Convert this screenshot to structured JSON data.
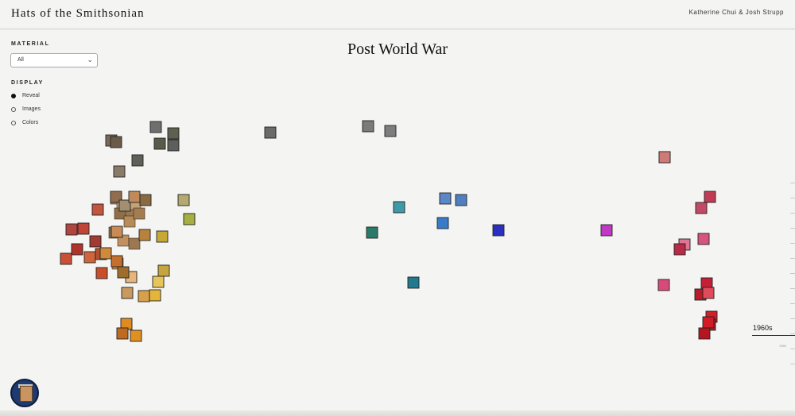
{
  "header": {
    "title": "Hats of the Smithsonian",
    "authors": "Katherine Chui & Josh Strupp"
  },
  "sidebar": {
    "material_label": "MATERIAL",
    "material_value": "All",
    "display_label": "DISPLAY",
    "display_options": [
      {
        "label": "Reveal",
        "selected": true
      },
      {
        "label": "Images",
        "selected": false
      },
      {
        "label": "Colors",
        "selected": false
      }
    ]
  },
  "main": {
    "title": "Post World War"
  },
  "timeline": {
    "decade": "1960s",
    "sub": "1960"
  },
  "swatches": [
    {
      "color": "#6f6f6f"
    },
    {
      "color": "#5e6050"
    },
    {
      "color": "#5a5a4a"
    },
    {
      "color": "#7b6a58"
    },
    {
      "color": "#6b5a48"
    },
    {
      "color": "#8a7a68"
    },
    {
      "color": "#5f5f58"
    },
    {
      "color": "#5d5f5c"
    },
    {
      "color": "#6a6a6a"
    },
    {
      "color": "#7a7a7a"
    },
    {
      "color": "#7d7d7d"
    },
    {
      "color": "#c98a87"
    },
    {
      "color": "#906d4f"
    },
    {
      "color": "#a38e70"
    },
    {
      "color": "#c08a5a"
    },
    {
      "color": "#8a6a40"
    },
    {
      "color": "#b5a870"
    },
    {
      "color": "#a5b040"
    },
    {
      "color": "#b0463f"
    },
    {
      "color": "#c04537"
    },
    {
      "color": "#a33a32"
    },
    {
      "color": "#c4543e"
    },
    {
      "color": "#b03329"
    },
    {
      "color": "#d0643a"
    },
    {
      "color": "#c95034"
    },
    {
      "color": "#c98a55"
    },
    {
      "color": "#b8823d"
    },
    {
      "color": "#c5a835"
    },
    {
      "color": "#b7512c"
    },
    {
      "color": "#d08a3c"
    },
    {
      "color": "#c4702c"
    },
    {
      "color": "#c94f2a"
    },
    {
      "color": "#e6b57a"
    },
    {
      "color": "#c6a540"
    },
    {
      "color": "#e6c55a"
    },
    {
      "color": "#d9a04a"
    },
    {
      "color": "#c89a60"
    },
    {
      "color": "#e5b43a"
    },
    {
      "color": "#a06e2a"
    },
    {
      "color": "#e08a20"
    },
    {
      "color": "#c06a20"
    },
    {
      "color": "#e0901e"
    },
    {
      "color": "#3d9aa6"
    },
    {
      "color": "#5a87c6"
    },
    {
      "color": "#4f7fc0"
    },
    {
      "color": "#3a7bc9"
    },
    {
      "color": "#2a7a6a"
    },
    {
      "color": "#2b30c0"
    },
    {
      "color": "#217a8e"
    },
    {
      "color": "#c039c4"
    },
    {
      "color": "#d07a78"
    },
    {
      "color": "#c13b55"
    },
    {
      "color": "#c24a66"
    },
    {
      "color": "#d4567a"
    },
    {
      "color": "#e07494"
    },
    {
      "color": "#b82a45"
    },
    {
      "color": "#d84a7a"
    },
    {
      "color": "#c51f37"
    },
    {
      "color": "#b81b2a"
    },
    {
      "color": "#e04a5a"
    },
    {
      "color": "#d0202a"
    },
    {
      "color": "#c01e26"
    },
    {
      "color": "#b5151e"
    },
    {
      "color": "#d11c28"
    }
  ]
}
